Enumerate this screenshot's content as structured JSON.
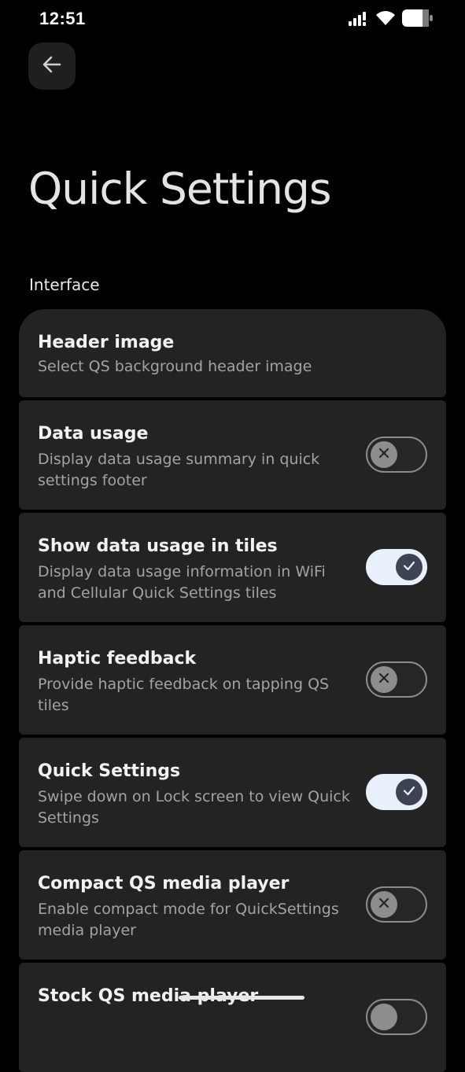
{
  "status": {
    "time": "12:51",
    "icons": [
      "signal-icon",
      "wifi-icon",
      "battery-icon"
    ]
  },
  "header": {
    "back_icon": "arrow-left-icon",
    "title": "Quick Settings"
  },
  "section": {
    "label": "Interface"
  },
  "items": [
    {
      "title": "Header image",
      "subtitle": "Select QS background header image",
      "toggle": null
    },
    {
      "title": "Data usage",
      "subtitle": "Display data usage summary in quick settings footer",
      "toggle": false
    },
    {
      "title": "Show data usage in tiles",
      "subtitle": "Display data usage information in WiFi and Cellular Quick Settings tiles",
      "toggle": true
    },
    {
      "title": "Haptic feedback",
      "subtitle": "Provide haptic feedback on tapping QS tiles",
      "toggle": false
    },
    {
      "title": "Quick Settings",
      "subtitle": "Swipe down on Lock screen to view Quick Settings",
      "toggle": true
    },
    {
      "title": "Compact QS media player",
      "subtitle": "Enable compact mode for QuickSettings media player",
      "toggle": false
    },
    {
      "title": "Stock QS media player",
      "subtitle": "",
      "toggle": false
    }
  ],
  "colors": {
    "background": "#000000",
    "card": "#232323",
    "toggle_on_track": "#e8f0fb",
    "toggle_on_knob": "#3d4350",
    "toggle_off_knob": "#8d8d8d"
  }
}
